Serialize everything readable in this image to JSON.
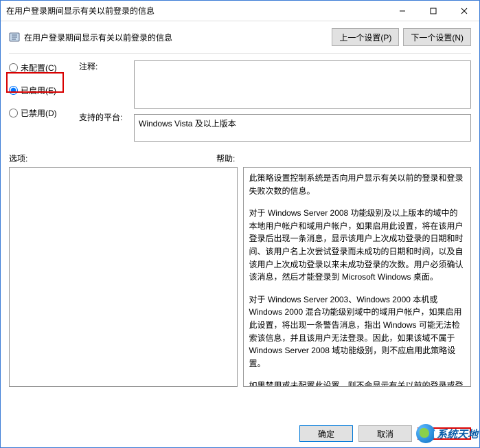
{
  "window": {
    "title": "在用户登录期间显示有关以前登录的信息"
  },
  "subtitle": {
    "text": "在用户登录期间显示有关以前登录的信息"
  },
  "nav": {
    "prev": "上一个设置(P)",
    "next": "下一个设置(N)"
  },
  "radios": {
    "not_configured": "未配置(C)",
    "enabled": "已启用(E)",
    "disabled": "已禁用(D)"
  },
  "labels": {
    "note": "注释:",
    "platform": "支持的平台:",
    "options": "选项:",
    "help": "帮助:"
  },
  "note_value": "",
  "platform_value": "Windows Vista 及以上版本",
  "help": {
    "p1": "此策略设置控制系统是否向用户显示有关以前的登录和登录失败次数的信息。",
    "p2": "对于 Windows Server 2008 功能级别及以上版本的域中的本地用户帐户和域用户帐户，如果启用此设置，将在该用户登录后出现一条消息，显示该用户上次成功登录的日期和时间、该用户名上次尝试登录而未成功的日期和时间，以及自该用户上次成功登录以来未成功登录的次数。用户必须确认该消息，然后才能登录到 Microsoft Windows 桌面。",
    "p3": "对于 Windows Server 2003、Windows 2000 本机或 Windows 2000 混合功能级别域中的域用户帐户，如果启用此设置，将出现一条警告消息，指出 Windows 可能无法检索该信息，并且该用户无法登录。因此，如果该域不属于 Windows Server 2008 域功能级别，则不应启用此策略设置。",
    "p4": "如果禁用或未配置此设置，则不会显示有关以前的登录或登录失败的消息。"
  },
  "footer": {
    "ok": "确定",
    "cancel": "取消"
  },
  "watermark": "系统天地"
}
